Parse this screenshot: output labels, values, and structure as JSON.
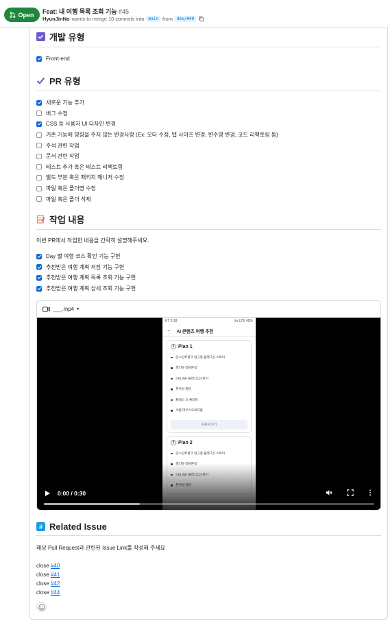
{
  "header": {
    "status": "Open",
    "title": "Feat: 내 여행 목록 조회 기능",
    "number": "#45",
    "author": "HyunJinNo",
    "merge_text": "wants to merge 10 commits into",
    "base_branch": "main",
    "from_text": "from",
    "head_branch": "dev/#40",
    "accent": "#1f883d"
  },
  "dev_type": {
    "icon": "checked-box-emoji-icon",
    "title": "개발 유형",
    "items": [
      {
        "label": "Front-end",
        "checked": true
      }
    ]
  },
  "pr_type": {
    "icon": "check-mark-emoji-icon",
    "title": "PR 유형",
    "items": [
      {
        "label": "새로운 기능 추가",
        "checked": true
      },
      {
        "label": "버그 수정",
        "checked": false
      },
      {
        "label": "CSS 등 사용자 UI 디자인 변경",
        "checked": true
      },
      {
        "label": "기존 기능에 영향을 주지 않는 변경사항 (Ex. 오타 수정, 탭 사이즈 변경, 변수명 변경, 코드 리팩토링 등)",
        "checked": false
      },
      {
        "label": "주석 관련 작업",
        "checked": false
      },
      {
        "label": "문서 관련 작업",
        "checked": false
      },
      {
        "label": "테스트 추가 혹은 테스트 리팩토링",
        "checked": false
      },
      {
        "label": "빌드 부분 혹은 패키지 매니저 수정",
        "checked": false
      },
      {
        "label": "파일 혹은 폴더명 수정",
        "checked": false
      },
      {
        "label": "파일 혹은 폴더 삭제",
        "checked": false
      }
    ]
  },
  "work": {
    "icon": "memo-emoji-icon",
    "title": "작업 내용",
    "description": "이번 PR에서 작업한 내용을 간략히 설명해주세요.",
    "items": [
      {
        "label": "Day 별 여행 코스 확인 기능 구현",
        "checked": true
      },
      {
        "label": "추천받은 여행 계획 저장 기능 구현",
        "checked": true
      },
      {
        "label": "추천받은 여행 계획 목록 조회 기능 구현",
        "checked": true
      },
      {
        "label": "추천받은 여행 계획 상세 조회 기능 구현",
        "checked": true
      }
    ]
  },
  "video": {
    "filename": "___.mp4",
    "time": "0:00 / 0:30",
    "buffered_fraction": 0.29,
    "phone": {
      "status_left": "KT 3:28",
      "status_right": "Vo LTE 45%",
      "screen_title": "AI 콘텐츠 여행 추천",
      "plans": [
        {
          "number": "1",
          "title": "Plan 1",
          "places": [
            "인스턴트펑크 압구정 플래그십 스토어",
            "힐리핏 청담본점",
            "CELINE 플래그십스토어",
            "본아성 청담",
            "플레스 오 플러워",
            "서울 마우스오브다름"
          ],
          "button": "자세히 보기"
        },
        {
          "number": "2",
          "title": "Plan 2",
          "places": [
            "인스턴트펑크 압구정 플래그십 스토어",
            "힐리핏 청담본점",
            "CELINE 플래그십스토어",
            "본아성 청담"
          ]
        }
      ]
    }
  },
  "related": {
    "icon": "hash-emoji-icon",
    "title": "Related Issue",
    "description": "해당 Pull Request과 관련된 Issue Link를 작성해 주세요",
    "closes": [
      {
        "prefix": "close",
        "issue": "#40"
      },
      {
        "prefix": "close",
        "issue": "#41"
      },
      {
        "prefix": "close",
        "issue": "#42"
      },
      {
        "prefix": "close",
        "issue": "#44"
      }
    ]
  }
}
